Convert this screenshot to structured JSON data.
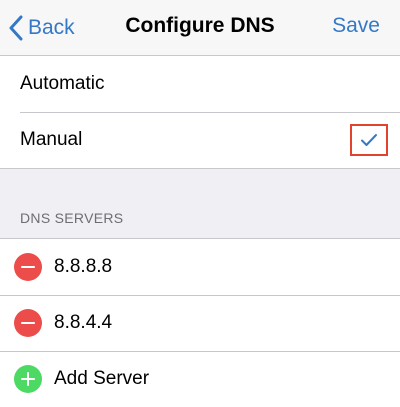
{
  "navbar": {
    "back_label": "Back",
    "title": "Configure DNS",
    "save_label": "Save"
  },
  "mode": {
    "options": [
      {
        "label": "Automatic",
        "selected": false
      },
      {
        "label": "Manual",
        "selected": true
      }
    ]
  },
  "servers": {
    "header": "DNS SERVERS",
    "items": [
      {
        "address": "8.8.8.8"
      },
      {
        "address": "8.8.4.4"
      }
    ],
    "add_label": "Add Server"
  },
  "colors": {
    "accent": "#3478c6",
    "delete": "#ed4d4a",
    "add": "#4cd964",
    "highlight": "#e2432d"
  },
  "icons": {
    "back": "chevron-left-icon",
    "checkmark": "checkmark-icon",
    "remove": "minus-circle-icon",
    "add": "plus-circle-icon"
  }
}
